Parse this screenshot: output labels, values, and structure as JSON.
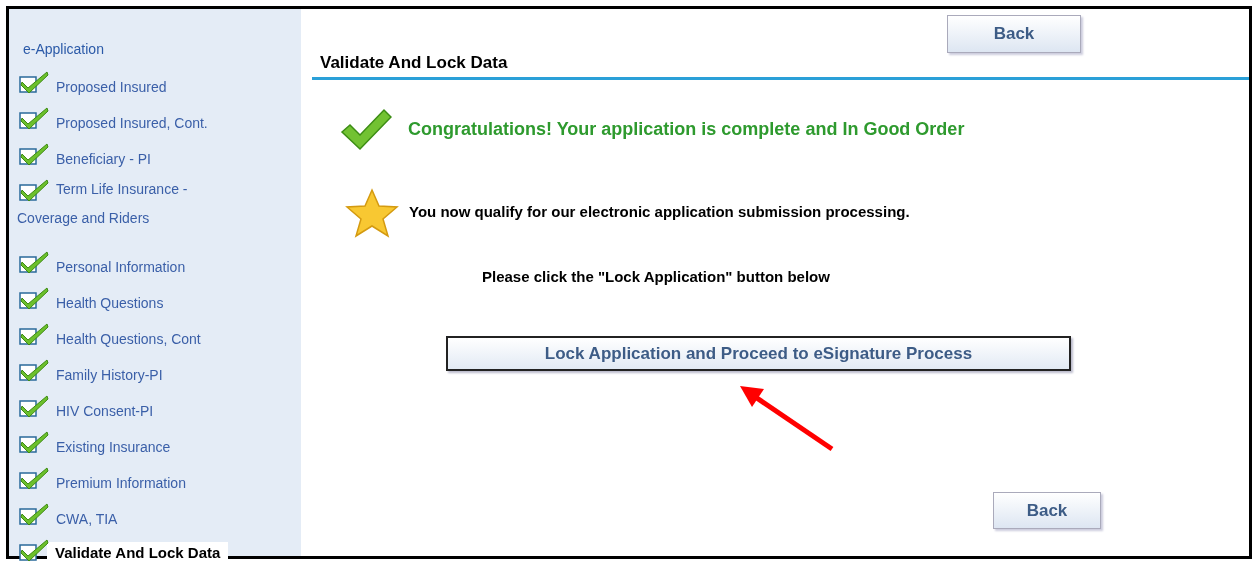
{
  "sidebar": {
    "heading": "e-Application",
    "items": [
      {
        "label": "Proposed Insured",
        "selected": false
      },
      {
        "label": "Proposed Insured, Cont.",
        "selected": false
      },
      {
        "label": "Beneficiary - PI",
        "selected": false
      },
      {
        "label": "Term Life Insurance - Coverage and Riders",
        "selected": false
      },
      {
        "label": "Personal Information",
        "selected": false
      },
      {
        "label": "Health Questions",
        "selected": false
      },
      {
        "label": "Health Questions, Cont",
        "selected": false
      },
      {
        "label": "Family History-PI",
        "selected": false
      },
      {
        "label": "HIV Consent-PI",
        "selected": false
      },
      {
        "label": "Existing Insurance",
        "selected": false
      },
      {
        "label": "Premium Information",
        "selected": false
      },
      {
        "label": "CWA, TIA",
        "selected": false
      },
      {
        "label": "Validate And Lock Data",
        "selected": true
      }
    ]
  },
  "main": {
    "top_button": "Back",
    "title": "Validate And Lock Data",
    "success_message": "Congratulations! Your application is complete and In Good Order",
    "qualify_message": "You now qualify for our electronic application submission processing.",
    "instruction": "Please click the \"Lock Application\" button below",
    "lock_button": "Lock Application and Proceed to eSignature Process",
    "bottom_button": "Back"
  }
}
